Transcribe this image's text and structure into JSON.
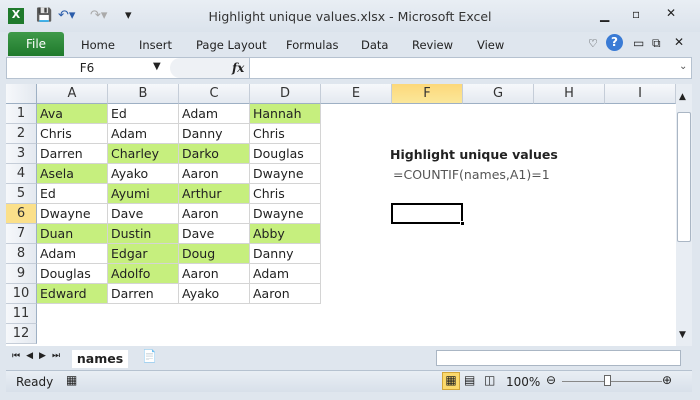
{
  "window": {
    "title": "Highlight unique values.xlsx  -  Microsoft Excel"
  },
  "ribbon": {
    "tabs": [
      "File",
      "Home",
      "Insert",
      "Page Layout",
      "Formulas",
      "Data",
      "Review",
      "View"
    ]
  },
  "formula_bar": {
    "name_box": "F6",
    "fx": "fx",
    "formula": ""
  },
  "columns": [
    "A",
    "B",
    "C",
    "D",
    "E",
    "F",
    "G",
    "H",
    "I"
  ],
  "selected_column": "F",
  "selected_row": 6,
  "rows": [
    [
      "Ava",
      "Ed",
      "Adam",
      "Hannah"
    ],
    [
      "Chris",
      "Adam",
      "Danny",
      "Chris"
    ],
    [
      "Darren",
      "Charley",
      "Darko",
      "Douglas"
    ],
    [
      "Asela",
      "Ayako",
      "Aaron",
      "Dwayne"
    ],
    [
      "Ed",
      "Ayumi",
      "Arthur",
      "Chris"
    ],
    [
      "Dwayne",
      "Dave",
      "Aaron",
      "Dwayne"
    ],
    [
      "Duan",
      "Dustin",
      "Dave",
      "Abby"
    ],
    [
      "Adam",
      "Edgar",
      "Doug",
      "Danny"
    ],
    [
      "Douglas",
      "Adolfo",
      "Aaron",
      "Adam"
    ],
    [
      "Edward",
      "Darren",
      "Ayako",
      "Aaron"
    ]
  ],
  "highlighted": [
    [
      1,
      0
    ],
    [
      1,
      3
    ],
    [
      3,
      1
    ],
    [
      3,
      2
    ],
    [
      4,
      0
    ],
    [
      5,
      1
    ],
    [
      5,
      2
    ],
    [
      7,
      0
    ],
    [
      7,
      1
    ],
    [
      7,
      3
    ],
    [
      8,
      1
    ],
    [
      8,
      2
    ],
    [
      9,
      1
    ],
    [
      10,
      0
    ]
  ],
  "highlight_color": "#c6ef7e",
  "row_numbers": [
    "1",
    "2",
    "3",
    "4",
    "5",
    "6",
    "7",
    "8",
    "9",
    "10",
    "11",
    "12"
  ],
  "note": {
    "title": "Highlight unique values",
    "formula": "=COUNTIF(names,A1)=1"
  },
  "sheet_tab": "names",
  "status": {
    "ready": "Ready",
    "zoom": "100%"
  }
}
